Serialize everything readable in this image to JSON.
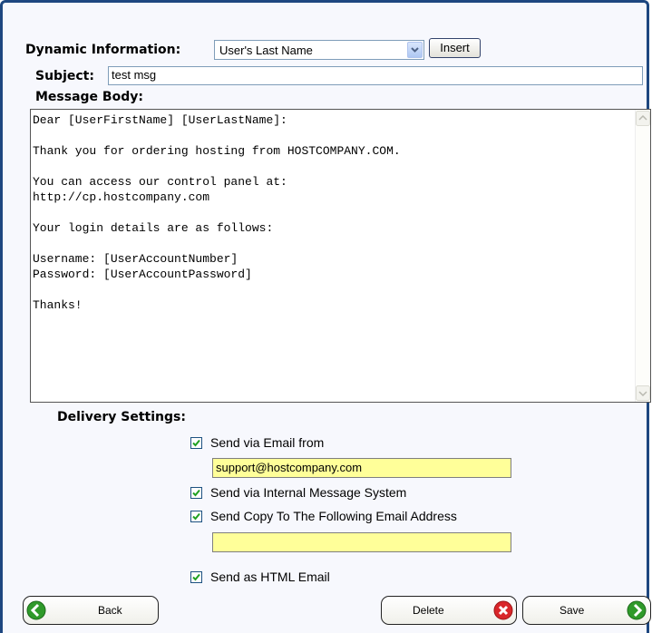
{
  "form": {
    "dynamic_label": "Dynamic Information:",
    "dynamic_selected": "User's Last Name",
    "insert_label": "Insert",
    "subject_label": "Subject:",
    "subject_value": "test msg",
    "body_label": "Message Body:",
    "body_value": "Dear [UserFirstName] [UserLastName]:\n\nThank you for ordering hosting from HOSTCOMPANY.COM.\n\nYou can access our control panel at:\nhttp://cp.hostcompany.com\n\nYour login details are as follows:\n\nUsername: [UserAccountNumber]\nPassword: [UserAccountPassword]\n\nThanks!"
  },
  "delivery": {
    "heading": "Delivery Settings:",
    "email_from_label": "Send via Email from",
    "email_from_value": "support@hostcompany.com",
    "internal_label": "Send via Internal Message System",
    "copy_label": "Send Copy To The Following Email Address",
    "copy_value": "",
    "html_label": "Send as HTML Email",
    "checked": [
      true,
      true,
      true,
      true
    ]
  },
  "buttons": {
    "back": "Back",
    "delete": "Delete",
    "save": "Save"
  },
  "colors": {
    "frame_border": "#1e4780",
    "highlight_input": "#ffff99",
    "back_icon": "#2f9a2a",
    "delete_icon": "#d9262a"
  }
}
